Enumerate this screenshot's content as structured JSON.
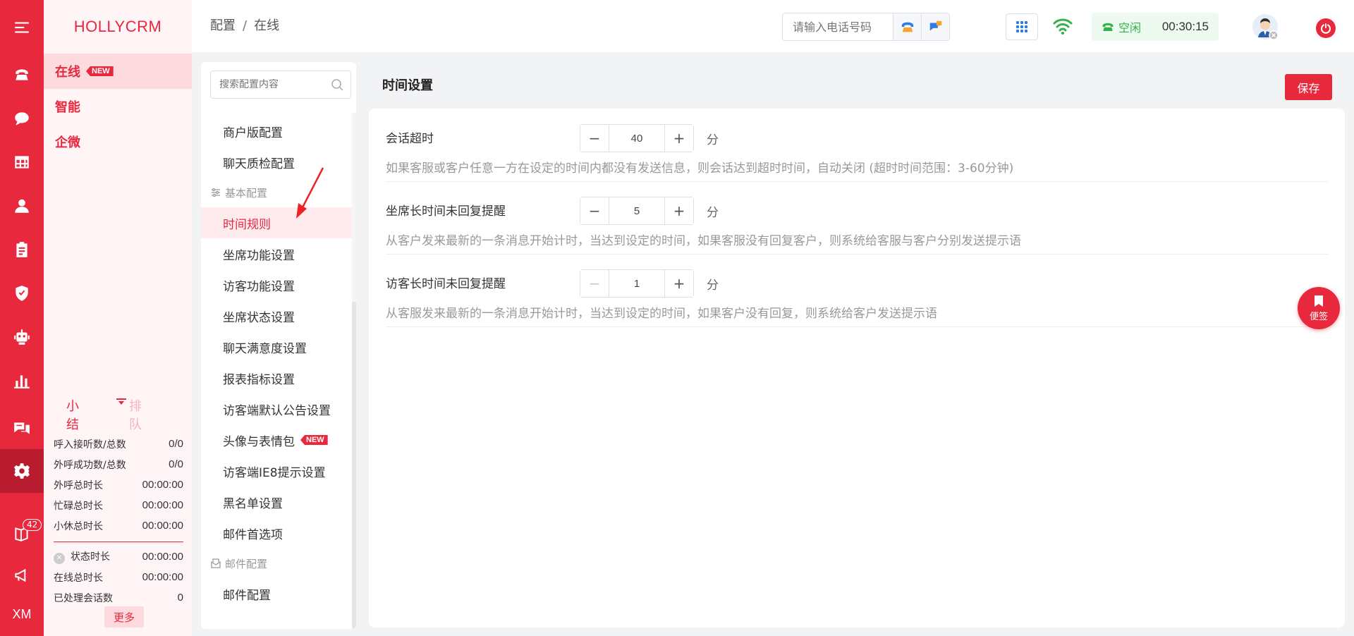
{
  "rail": {
    "badge_count": "42",
    "bottom_text": "XM",
    "icons": [
      "menu-icon",
      "phone-icon",
      "chat-icon",
      "table-icon",
      "user-icon",
      "clipboard-icon",
      "shield-icon",
      "robot-icon",
      "bar-chart-icon",
      "messages-icon",
      "settings-icon",
      "book-icon",
      "megaphone-icon"
    ]
  },
  "col2": {
    "brand": "HOLLYCRM",
    "items": [
      {
        "label": "在线",
        "tag": "NEW"
      },
      {
        "label": "智能"
      },
      {
        "label": "企微"
      }
    ],
    "stats_tabs": [
      "小结",
      "排队"
    ],
    "stats": [
      {
        "label": "呼入接听数/总数",
        "value": "0/0"
      },
      {
        "label": "外呼成功数/总数",
        "value": "0/0"
      },
      {
        "label": "外呼总时长",
        "value": "00:00:00"
      },
      {
        "label": "忙碌总时长",
        "value": "00:00:00"
      },
      {
        "label": "小休总时长",
        "value": "00:00:00"
      }
    ],
    "stats2": [
      {
        "label": "状态时长",
        "value": "00:00:00"
      },
      {
        "label": "在线总时长",
        "value": "00:00:00"
      },
      {
        "label": "已处理会话数",
        "value": "0"
      }
    ],
    "more": "更多"
  },
  "topbar": {
    "breadcrumb": [
      "配置",
      "在线"
    ],
    "breadcrumb_sep": "/",
    "phone_placeholder": "请输入电话号码",
    "status": "空闲",
    "timer": "00:30:15"
  },
  "menu": {
    "search_placeholder": "搜索配置内容",
    "items": [
      {
        "label": "商户版配置"
      },
      {
        "label": "聊天质检配置"
      },
      {
        "label": "基本配置",
        "group": true
      },
      {
        "label": "时间规则",
        "active": true
      },
      {
        "label": "坐席功能设置"
      },
      {
        "label": "访客功能设置"
      },
      {
        "label": "坐席状态设置"
      },
      {
        "label": "聊天满意度设置"
      },
      {
        "label": "报表指标设置"
      },
      {
        "label": "访客端默认公告设置"
      },
      {
        "label": "头像与表情包",
        "tag": "NEW"
      },
      {
        "label": "访客端IE8提示设置"
      },
      {
        "label": "黑名单设置"
      },
      {
        "label": "邮件首选项"
      },
      {
        "label": "邮件配置",
        "group": true
      },
      {
        "label": "邮件配置"
      }
    ]
  },
  "content": {
    "title": "时间设置",
    "save": "保存",
    "settings": [
      {
        "label": "会话超时",
        "value": "40",
        "unit": "分",
        "minus_disabled": false,
        "desc": "如果客服或客户任意一方在设定的时间内都没有发送信息，则会话达到超时时间，自动关闭 (超时时间范围：3-60分钟)"
      },
      {
        "label": "坐席长时间未回复提醒",
        "value": "5",
        "unit": "分",
        "minus_disabled": false,
        "desc": "从客户发来最新的一条消息开始计时，当达到设定的时间，如果客服没有回复客户，则系统给客服与客户分别发送提示语"
      },
      {
        "label": "访客长时间未回复提醒",
        "value": "1",
        "unit": "分",
        "minus_disabled": true,
        "desc": "从客服发来最新的一条消息开始计时，当达到设定的时间，如果客户没有回复，则系统给客户发送提示语"
      }
    ],
    "float_note": "便签"
  },
  "colors": {
    "brand_red": "#e8283d",
    "status_green": "#2fb34a"
  }
}
